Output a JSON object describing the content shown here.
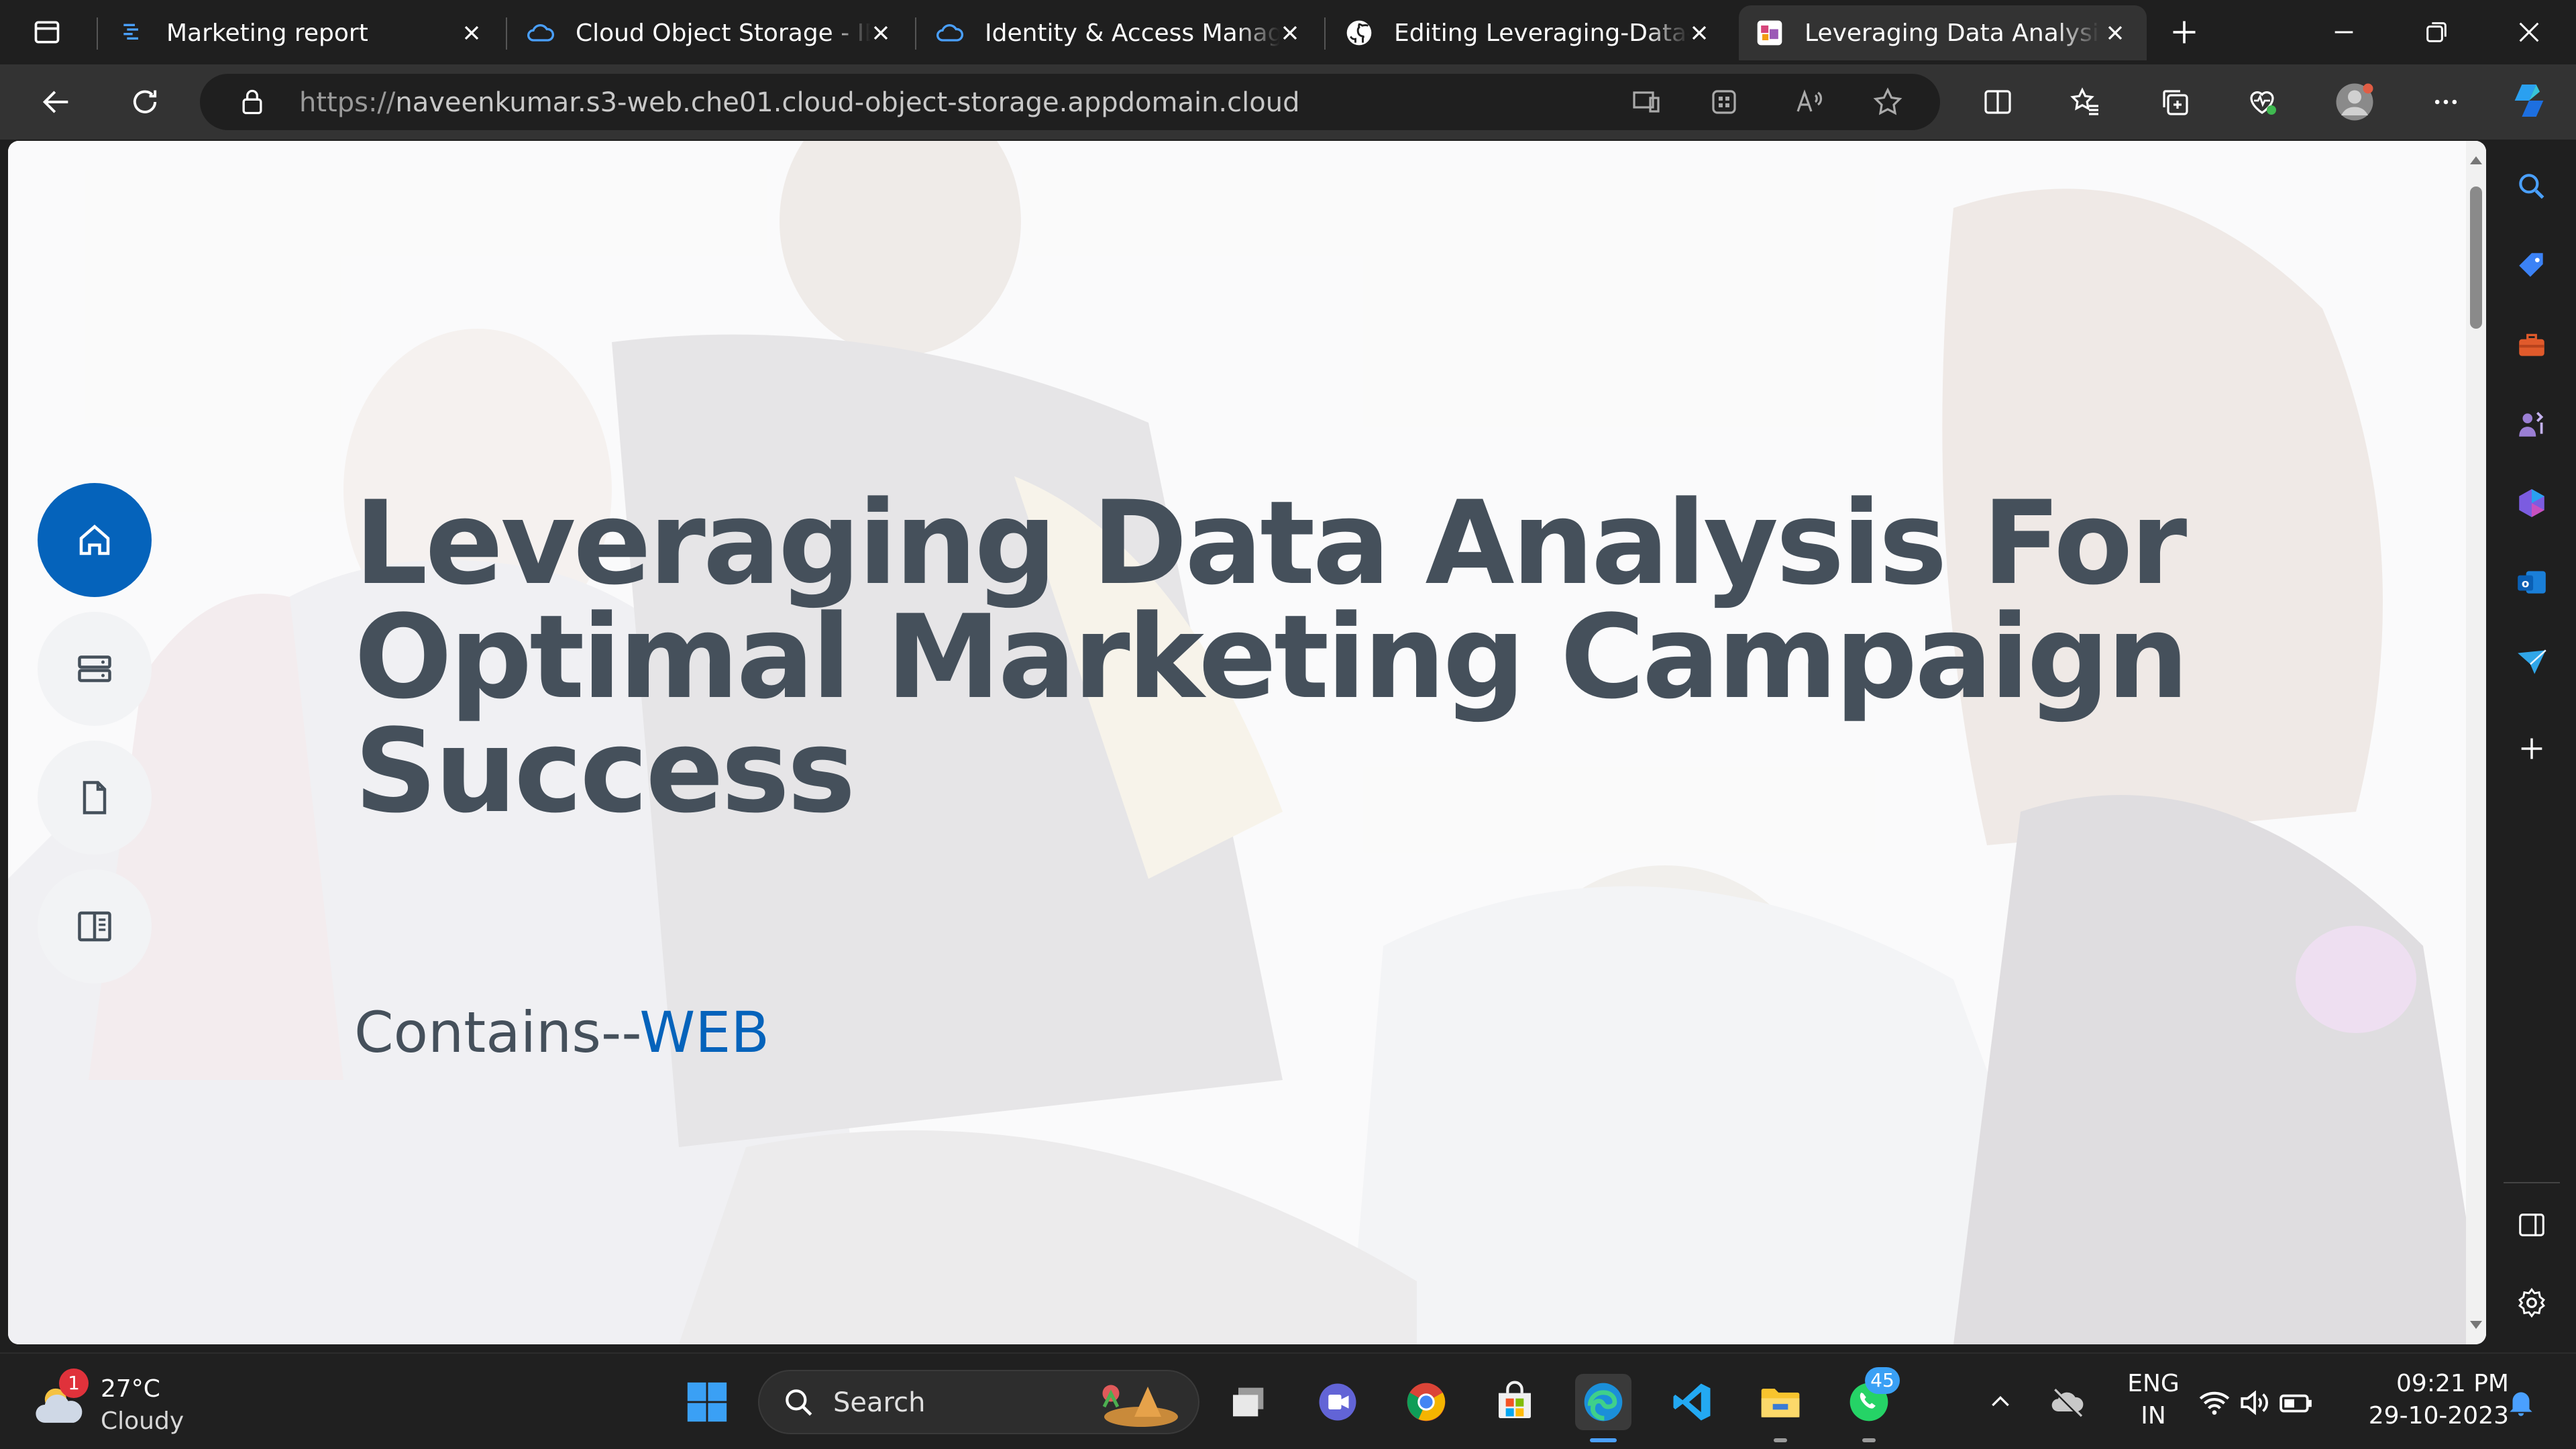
{
  "browser": {
    "tabs": [
      {
        "title": "Marketing report",
        "active": false
      },
      {
        "title": "Cloud Object Storage - IBM Cloud",
        "active": false
      },
      {
        "title": "Identity & Access Management",
        "active": false
      },
      {
        "title": "Editing Leveraging-Data-Analysis",
        "active": false
      },
      {
        "title": "Leveraging Data Analysis For Optimal",
        "active": true
      }
    ],
    "url_scheme": "https://",
    "url_host": "naveenkumar.s3-web.che01.cloud-object-storage.appdomain.cloud",
    "accent": "#0563bb"
  },
  "page": {
    "hero_title": "Leveraging Data Analysis For Optimal Marketing Campaign Success",
    "hero_prefix": "Contains--",
    "hero_typed": "WEB",
    "nav": [
      {
        "icon": "home-icon",
        "active": true
      },
      {
        "icon": "server-icon",
        "active": false
      },
      {
        "icon": "file-icon",
        "active": false
      },
      {
        "icon": "book-icon",
        "active": false
      }
    ]
  },
  "taskbar": {
    "weather_temp": "27°C",
    "weather_desc": "Cloudy",
    "weather_badge": "1",
    "search_label": "Search",
    "whatsapp_badge": "45",
    "lang_1": "ENG",
    "lang_2": "IN",
    "time": "09:21 PM",
    "date": "29-10-2023"
  }
}
